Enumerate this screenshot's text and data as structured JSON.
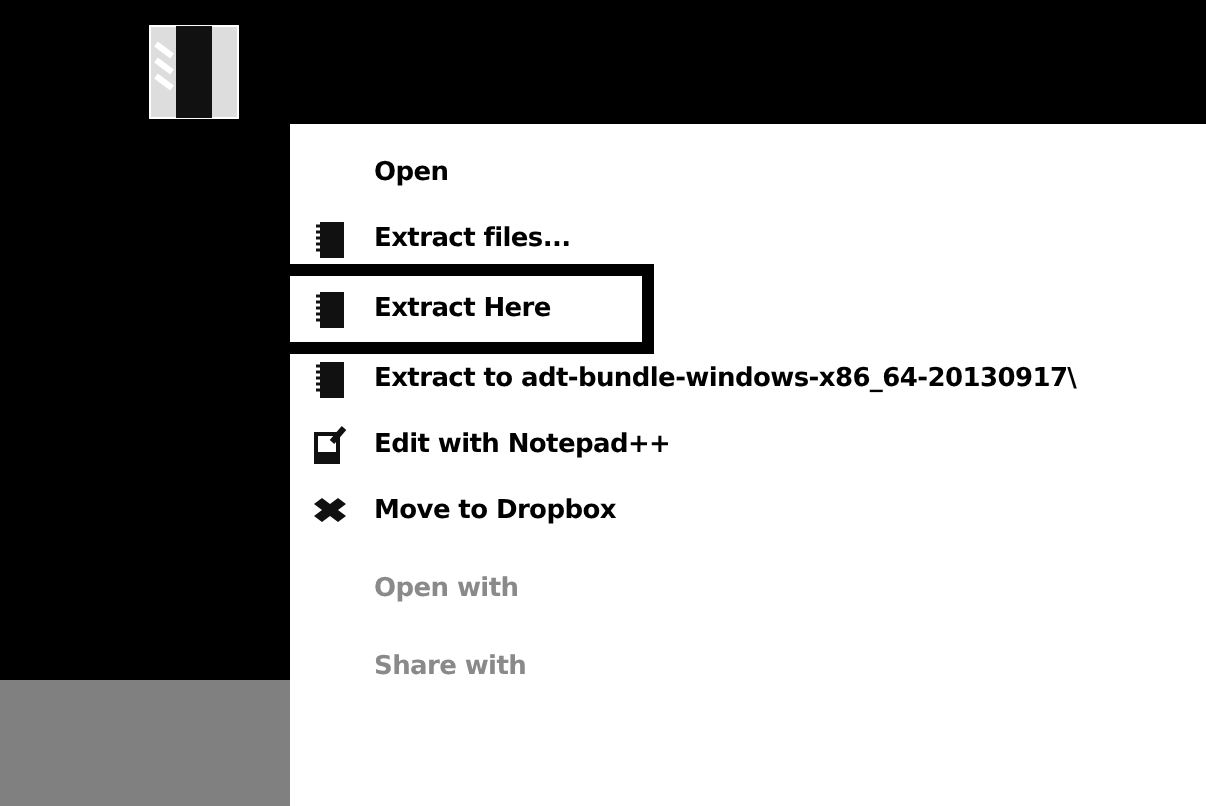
{
  "menu": {
    "items": [
      {
        "label": "Open",
        "kind": "plain",
        "disabled": false,
        "highlighted": false
      },
      {
        "label": "Extract files...",
        "kind": "archive",
        "disabled": false,
        "highlighted": false
      },
      {
        "label": "Extract Here",
        "kind": "archive",
        "disabled": false,
        "highlighted": true
      },
      {
        "label": "Extract to adt-bundle-windows-x86_64-20130917\\",
        "kind": "archive",
        "disabled": false,
        "highlighted": false
      },
      {
        "label": "Edit with Notepad++",
        "kind": "notepad",
        "disabled": false,
        "highlighted": false
      },
      {
        "label": "Move to Dropbox",
        "kind": "dropbox",
        "disabled": false,
        "highlighted": false
      },
      {
        "label": "Open with",
        "kind": "plain",
        "disabled": true,
        "highlighted": false
      },
      {
        "label": "Share with",
        "kind": "plain",
        "disabled": true,
        "highlighted": false
      }
    ]
  }
}
